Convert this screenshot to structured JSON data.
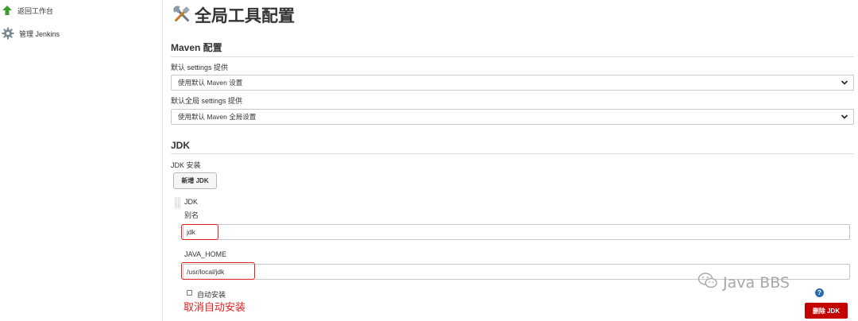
{
  "sidebar": {
    "items": [
      {
        "label": "返回工作台",
        "icon": "up-arrow-icon"
      },
      {
        "label": "管理 Jenkins",
        "icon": "gear-icon"
      }
    ]
  },
  "page": {
    "title": "全局工具配置",
    "title_icon": "tools-icon"
  },
  "maven": {
    "heading": "Maven 配置",
    "settings_label": "默认 settings 提供",
    "settings_value": "使用默认 Maven 设置",
    "global_settings_label": "默认全局 settings 提供",
    "global_settings_value": "使用默认 Maven 全局设置"
  },
  "jdk": {
    "heading": "JDK",
    "install_label": "JDK 安装",
    "add_button": "新增 JDK",
    "entry_title": "JDK",
    "alias_label": "别名",
    "alias_value": "jdk",
    "java_home_label": "JAVA_HOME",
    "java_home_value": "/usr/local/jdk",
    "auto_install_label": "自动安装",
    "auto_install_checked": false,
    "annotation": "取消自动安装",
    "delete_button": "删除 JDK"
  },
  "help_icon": "?",
  "watermark": "Java BBS",
  "colors": {
    "annotation_red": "#e02020",
    "delete_button_bg": "#c40000",
    "help_blue": "#2a68b0"
  }
}
